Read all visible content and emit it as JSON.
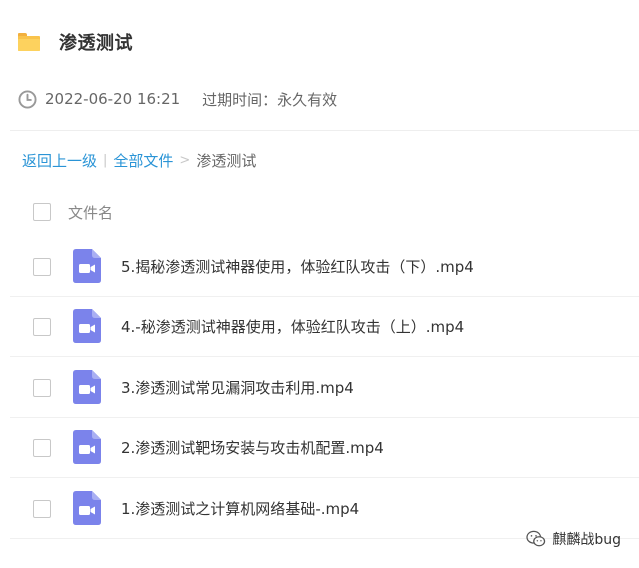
{
  "header": {
    "title": "渗透测试",
    "folder_icon": "folder-icon"
  },
  "meta": {
    "date": "2022-06-20 16:21",
    "expiry": "过期时间：永久有效",
    "clock_icon": "clock-icon"
  },
  "breadcrumb": {
    "back": "返回上一级",
    "separator1": "|",
    "all_files": "全部文件",
    "separator2": ">",
    "current": "渗透测试"
  },
  "list": {
    "column_name": "文件名",
    "files": [
      {
        "name": "5.揭秘渗透测试神器使用，体验红队攻击（下）.mp4",
        "icon": "video-file-icon"
      },
      {
        "name": "4.-秘渗透测试神器使用，体验红队攻击（上）.mp4",
        "icon": "video-file-icon"
      },
      {
        "name": "3.渗透测试常见漏洞攻击利用.mp4",
        "icon": "video-file-icon"
      },
      {
        "name": "2.渗透测试靶场安装与攻击机配置.mp4",
        "icon": "video-file-icon"
      },
      {
        "name": "1.渗透测试之计算机网络基础-.mp4",
        "icon": "video-file-icon"
      }
    ]
  },
  "watermark": {
    "text": "麒麟战bug",
    "icon": "wechat-icon"
  },
  "colors": {
    "link": "#2a94d6",
    "video_icon": "#7b83eb",
    "folder": "#f9c34b"
  }
}
